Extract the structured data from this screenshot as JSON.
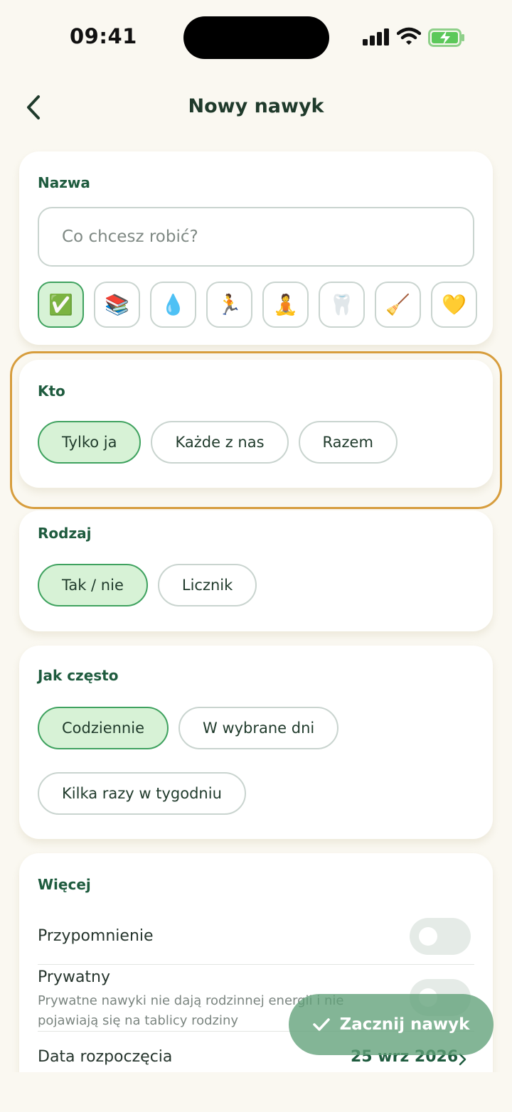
{
  "status": {
    "time": "09:41"
  },
  "header": {
    "title": "Nowy nawyk"
  },
  "name_card": {
    "label": "Nazwa",
    "placeholder": "Co chcesz robić?",
    "icons": [
      {
        "emoji": "✅",
        "name": "check-mark-icon",
        "selected": true
      },
      {
        "emoji": "📚",
        "name": "books-icon"
      },
      {
        "emoji": "💧",
        "name": "droplet-icon"
      },
      {
        "emoji": "🏃",
        "name": "runner-icon"
      },
      {
        "emoji": "🧘",
        "name": "meditation-icon"
      },
      {
        "emoji": "🦷",
        "name": "tooth-icon"
      },
      {
        "emoji": "🧹",
        "name": "broom-icon"
      },
      {
        "emoji": "💛",
        "name": "yellow-heart-icon"
      }
    ]
  },
  "who_card": {
    "label": "Kto",
    "options": [
      "Tylko ja",
      "Każde z nas",
      "Razem"
    ],
    "selected": "Tylko ja"
  },
  "kind_card": {
    "label": "Rodzaj",
    "options": [
      "Tak / nie",
      "Licznik"
    ],
    "selected": "Tak / nie"
  },
  "freq_card": {
    "label": "Jak często",
    "options": [
      "Codziennie",
      "W wybrane dni",
      "Kilka razy w tygodniu"
    ],
    "selected": "Codziennie"
  },
  "more_card": {
    "label": "Więcej",
    "reminder_label": "Przypomnienie",
    "reminder_on": false,
    "private_label": "Prywatny",
    "private_desc": "Prywatne nawyki nie dają rodzinnej energii i nie pojawiają się na tablicy rodziny",
    "private_on": false,
    "start_label": "Data rozpoczęcia",
    "start_value": "25 wrz 2026"
  },
  "cta": {
    "label": "Zacznij nawyk"
  },
  "colors": {
    "accent": "#1e5b3e",
    "selected_bg": "#d7f2d6",
    "highlight": "#d79d3d",
    "background": "#faf8f1"
  }
}
